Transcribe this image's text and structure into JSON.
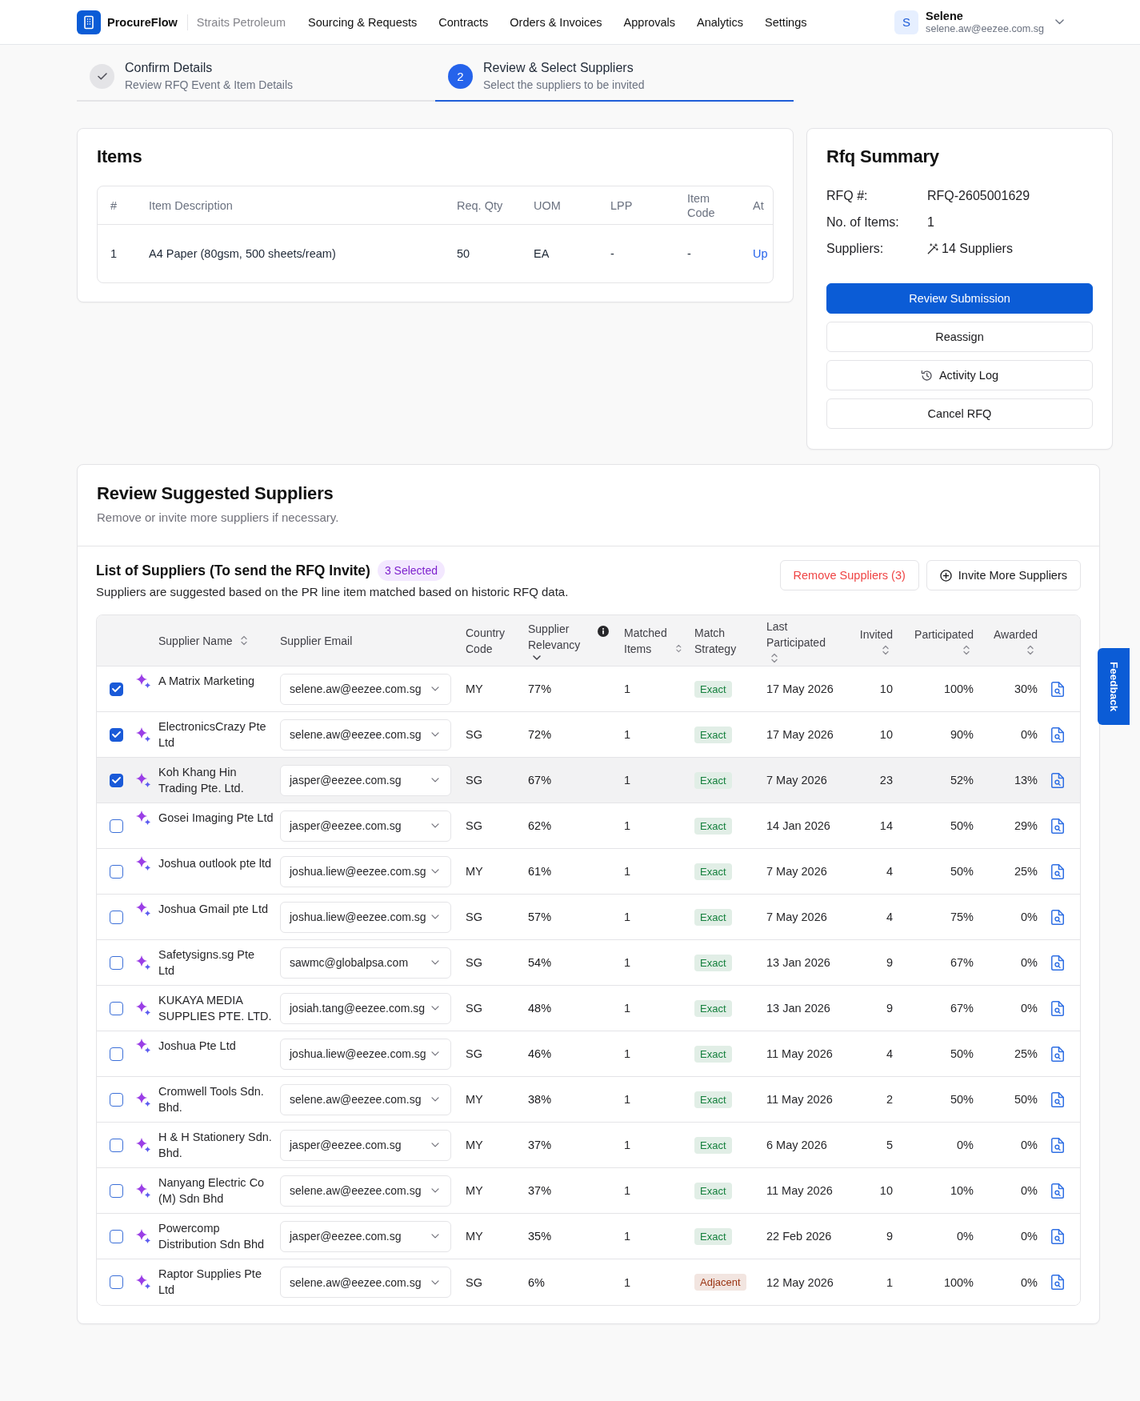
{
  "header": {
    "app_name": "ProcureFlow",
    "company": "Straits Petroleum",
    "nav": [
      "Sourcing & Requests",
      "Contracts",
      "Orders & Invoices",
      "Approvals",
      "Analytics",
      "Settings"
    ],
    "user": {
      "initial": "S",
      "name": "Selene",
      "email": "selene.aw@eezee.com.sg"
    }
  },
  "steps": [
    {
      "title": "Confirm Details",
      "subtitle": "Review RFQ Event & Item Details",
      "completed": true,
      "selected": false
    },
    {
      "number": "2",
      "title": "Review & Select Suppliers",
      "subtitle": "Select the suppliers to be invited",
      "completed": false,
      "selected": true
    }
  ],
  "items": {
    "title": "Items",
    "columns": [
      "#",
      "Item Description",
      "Req. Qty",
      "UOM",
      "LPP",
      "Item Code",
      "At"
    ],
    "rows": [
      {
        "cells": [
          "1",
          "A4 Paper (80gsm, 500 sheets/ream)",
          "50",
          "EA",
          "-",
          "-"
        ],
        "link": "Up"
      }
    ]
  },
  "summary": {
    "title": "Rfq Summary",
    "rows": [
      {
        "label": "RFQ #:",
        "value": "RFQ-2605001629",
        "kind": "text"
      },
      {
        "label": "No. of Items:",
        "value": "1",
        "kind": "text"
      },
      {
        "label": "Suppliers:",
        "value": "14 Suppliers",
        "kind": "with-icon"
      }
    ],
    "buttons": [
      {
        "label": "Review Submission",
        "kind": "primary"
      },
      {
        "label": "Reassign",
        "kind": "outline"
      },
      {
        "label": "Activity Log",
        "kind": "with-icon"
      },
      {
        "label": "Cancel RFQ",
        "kind": "outline"
      }
    ]
  },
  "suppliers": {
    "title": "Review Suggested Suppliers",
    "subtitle": "Remove or invite more suppliers if necessary.",
    "list_title": "List of Suppliers (To send the RFQ Invite)",
    "selected_badge": "3 Selected",
    "description": "Suppliers are suggested based on the PR line item matched based on historic RFQ data.",
    "buttons": [
      {
        "label": "Remove Suppliers (3)",
        "kind": "danger"
      },
      {
        "label": "Invite More Suppliers",
        "kind": "with-icon"
      }
    ],
    "columns": [
      {
        "label": "Supplier Name",
        "sortable": true,
        "sorted": false
      },
      {
        "label": "Supplier Email",
        "sortable": false,
        "sorted": false
      },
      {
        "label": "Country Code",
        "sortable": false,
        "sorted": false
      },
      {
        "label": "Supplier Relevancy",
        "sortable": true,
        "sorted": true,
        "has_info": true
      },
      {
        "label": "Matched Items",
        "sortable": true,
        "sorted": false
      },
      {
        "label": "Match Strategy",
        "sortable": false,
        "sorted": false
      },
      {
        "label": "Last Participated",
        "sortable": true,
        "sorted": false
      },
      {
        "label": "Invited",
        "sortable": true,
        "sorted": false
      },
      {
        "label": "Participated",
        "sortable": true,
        "sorted": false
      },
      {
        "label": "Awarded",
        "sortable": true,
        "sorted": false
      }
    ],
    "rows": [
      {
        "checked": true,
        "highlighted": false,
        "name": "A Matrix Marketing",
        "email": "selene.aw@eezee.com.sg",
        "country": "MY",
        "relevancy": "77%",
        "matched": "1",
        "strategy": {
          "label": "Exact",
          "color": "#15803d"
        },
        "last_participated": "17 May 2026",
        "invited": "10",
        "participated": "100%",
        "awarded": "30%"
      },
      {
        "checked": true,
        "highlighted": false,
        "name": "ElectronicsCrazy Pte Ltd",
        "email": "selene.aw@eezee.com.sg",
        "country": "SG",
        "relevancy": "72%",
        "matched": "1",
        "strategy": {
          "label": "Exact",
          "color": "#15803d"
        },
        "last_participated": "17 May 2026",
        "invited": "10",
        "participated": "90%",
        "awarded": "0%"
      },
      {
        "checked": true,
        "highlighted": true,
        "name": "Koh Khang Hin Trading Pte. Ltd.",
        "email": "jasper@eezee.com.sg",
        "country": "SG",
        "relevancy": "67%",
        "matched": "1",
        "strategy": {
          "label": "Exact",
          "color": "#15803d"
        },
        "last_participated": "7 May 2026",
        "invited": "23",
        "participated": "52%",
        "awarded": "13%"
      },
      {
        "checked": false,
        "highlighted": false,
        "name": "Gosei Imaging Pte Ltd",
        "email": "jasper@eezee.com.sg",
        "country": "SG",
        "relevancy": "62%",
        "matched": "1",
        "strategy": {
          "label": "Exact",
          "color": "#15803d"
        },
        "last_participated": "14 Jan 2026",
        "invited": "14",
        "participated": "50%",
        "awarded": "29%"
      },
      {
        "checked": false,
        "highlighted": false,
        "name": "Joshua outlook pte ltd",
        "email": "joshua.liew@eezee.com.sg",
        "country": "MY",
        "relevancy": "61%",
        "matched": "1",
        "strategy": {
          "label": "Exact",
          "color": "#15803d"
        },
        "last_participated": "7 May 2026",
        "invited": "4",
        "participated": "50%",
        "awarded": "25%"
      },
      {
        "checked": false,
        "highlighted": false,
        "name": "Joshua Gmail pte Ltd",
        "email": "joshua.liew@eezee.com.sg",
        "country": "SG",
        "relevancy": "57%",
        "matched": "1",
        "strategy": {
          "label": "Exact",
          "color": "#15803d"
        },
        "last_participated": "7 May 2026",
        "invited": "4",
        "participated": "75%",
        "awarded": "0%"
      },
      {
        "checked": false,
        "highlighted": false,
        "name": "Safetysigns.sg Pte Ltd",
        "email": "sawmc@globalpsa.com",
        "country": "SG",
        "relevancy": "54%",
        "matched": "1",
        "strategy": {
          "label": "Exact",
          "color": "#15803d"
        },
        "last_participated": "13 Jan 2026",
        "invited": "9",
        "participated": "67%",
        "awarded": "0%"
      },
      {
        "checked": false,
        "highlighted": false,
        "name": "KUKAYA MEDIA SUPPLIES PTE. LTD.",
        "email": "josiah.tang@eezee.com.sg",
        "country": "SG",
        "relevancy": "48%",
        "matched": "1",
        "strategy": {
          "label": "Exact",
          "color": "#15803d"
        },
        "last_participated": "13 Jan 2026",
        "invited": "9",
        "participated": "67%",
        "awarded": "0%"
      },
      {
        "checked": false,
        "highlighted": false,
        "name": "Joshua Pte Ltd",
        "email": "joshua.liew@eezee.com.sg",
        "country": "SG",
        "relevancy": "46%",
        "matched": "1",
        "strategy": {
          "label": "Exact",
          "color": "#15803d"
        },
        "last_participated": "11 May 2026",
        "invited": "4",
        "participated": "50%",
        "awarded": "25%"
      },
      {
        "checked": false,
        "highlighted": false,
        "name": "Cromwell Tools Sdn. Bhd.",
        "email": "selene.aw@eezee.com.sg",
        "country": "MY",
        "relevancy": "38%",
        "matched": "1",
        "strategy": {
          "label": "Exact",
          "color": "#15803d"
        },
        "last_participated": "11 May 2026",
        "invited": "2",
        "participated": "50%",
        "awarded": "50%"
      },
      {
        "checked": false,
        "highlighted": false,
        "name": "H & H Stationery Sdn. Bhd.",
        "email": "jasper@eezee.com.sg",
        "country": "MY",
        "relevancy": "37%",
        "matched": "1",
        "strategy": {
          "label": "Exact",
          "color": "#15803d"
        },
        "last_participated": "6 May 2026",
        "invited": "5",
        "participated": "0%",
        "awarded": "0%"
      },
      {
        "checked": false,
        "highlighted": false,
        "name": "Nanyang Electric Co (M) Sdn Bhd",
        "email": "selene.aw@eezee.com.sg",
        "country": "MY",
        "relevancy": "37%",
        "matched": "1",
        "strategy": {
          "label": "Exact",
          "color": "#15803d"
        },
        "last_participated": "11 May 2026",
        "invited": "10",
        "participated": "10%",
        "awarded": "0%"
      },
      {
        "checked": false,
        "highlighted": false,
        "name": "Powercomp Distribution Sdn Bhd",
        "email": "jasper@eezee.com.sg",
        "country": "MY",
        "relevancy": "35%",
        "matched": "1",
        "strategy": {
          "label": "Exact",
          "color": "#15803d"
        },
        "last_participated": "22 Feb 2026",
        "invited": "9",
        "participated": "0%",
        "awarded": "0%"
      },
      {
        "checked": false,
        "highlighted": false,
        "name": "Raptor Supplies Pte Ltd",
        "email": "selene.aw@eezee.com.sg",
        "country": "SG",
        "relevancy": "6%",
        "matched": "1",
        "strategy": {
          "label": "Adjacent",
          "color": "#9a3412"
        },
        "last_participated": "12 May 2026",
        "invited": "1",
        "participated": "100%",
        "awarded": "0%"
      }
    ]
  },
  "feedback": "Feedback"
}
